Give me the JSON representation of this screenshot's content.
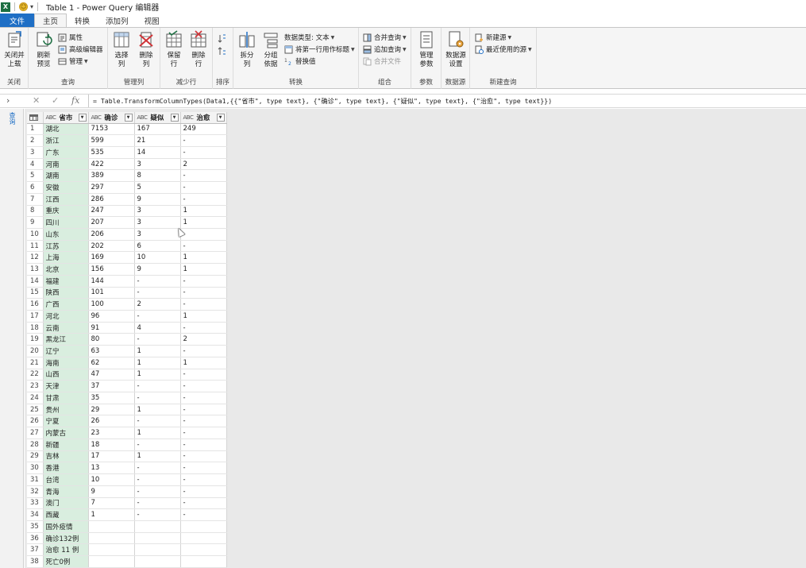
{
  "window": {
    "title": "Table 1 - Power Query 编辑器",
    "app_badge": "X"
  },
  "tabs": [
    "文件",
    "主页",
    "转换",
    "添加列",
    "视图"
  ],
  "ribbon": {
    "groups": {
      "close": "关闭",
      "query": "查询",
      "manage_cols": "管理列",
      "reduce_rows": "减少行",
      "sort": "排序",
      "transform": "转换",
      "combine": "组合",
      "params": "参数",
      "datasource": "数据源",
      "new_query": "新建查询"
    },
    "buttons": {
      "close_load": "关闭并\n上载",
      "refresh_preview": "刷新\n预览",
      "properties": "属性",
      "advanced_editor": "高级编辑器",
      "manage": "管理",
      "choose_columns": "选择\n列",
      "remove_columns": "删除\n列",
      "keep_rows": "保留\n行",
      "remove_rows": "删除\n行",
      "split_column": "拆分\n列",
      "group_by": "分组\n依据",
      "data_type": "数据类型: 文本",
      "first_row_header": "将第一行用作标题",
      "replace_values": "替换值",
      "merge_queries": "合并查询",
      "append_queries": "追加查询",
      "combine_files": "合并文件",
      "manage_params": "管理\n参数",
      "datasource_settings": "数据源\n设置",
      "new_source": "新建源",
      "recent_sources": "最近使用的源"
    }
  },
  "formula_bar": {
    "formula": "= Table.TransformColumnTypes(Data1,{{\"省市\", type text}, {\"确诊\", type text}, {\"疑似\", type text}, {\"治愈\", type text}})"
  },
  "query_pane": {
    "label": "查询"
  },
  "grid": {
    "columns": [
      {
        "type": "ABC",
        "name": "省市"
      },
      {
        "type": "ABC",
        "name": "确诊"
      },
      {
        "type": "ABC",
        "name": "疑似"
      },
      {
        "type": "ABC",
        "name": "治愈"
      }
    ],
    "rows": [
      [
        "湖北",
        "7153",
        "167",
        "249"
      ],
      [
        "浙江",
        "599",
        "21",
        "-"
      ],
      [
        "广东",
        "535",
        "14",
        "-"
      ],
      [
        "河南",
        "422",
        "3",
        "2"
      ],
      [
        "湖南",
        "389",
        "8",
        "-"
      ],
      [
        "安徽",
        "297",
        "5",
        "-"
      ],
      [
        "江西",
        "286",
        "9",
        "-"
      ],
      [
        "重庆",
        "247",
        "3",
        "1"
      ],
      [
        "四川",
        "207",
        "3",
        "1"
      ],
      [
        "山东",
        "206",
        "3",
        "-"
      ],
      [
        "江苏",
        "202",
        "6",
        "-"
      ],
      [
        "上海",
        "169",
        "10",
        "1"
      ],
      [
        "北京",
        "156",
        "9",
        "1"
      ],
      [
        "福建",
        "144",
        "-",
        "-"
      ],
      [
        "陕西",
        "101",
        "-",
        "-"
      ],
      [
        "广西",
        "100",
        "2",
        "-"
      ],
      [
        "河北",
        "96",
        "-",
        "1"
      ],
      [
        "云南",
        "91",
        "4",
        "-"
      ],
      [
        "黑龙江",
        "80",
        "-",
        "2"
      ],
      [
        "辽宁",
        "63",
        "1",
        "-"
      ],
      [
        "海南",
        "62",
        "1",
        "1"
      ],
      [
        "山西",
        "47",
        "1",
        "-"
      ],
      [
        "天津",
        "37",
        "-",
        "-"
      ],
      [
        "甘肃",
        "35",
        "-",
        "-"
      ],
      [
        "贵州",
        "29",
        "1",
        "-"
      ],
      [
        "宁夏",
        "26",
        "-",
        "-"
      ],
      [
        "内蒙古",
        "23",
        "1",
        "-"
      ],
      [
        "新疆",
        "18",
        "-",
        "-"
      ],
      [
        "吉林",
        "17",
        "1",
        "-"
      ],
      [
        "香港",
        "13",
        "-",
        "-"
      ],
      [
        "台湾",
        "10",
        "-",
        "-"
      ],
      [
        "青海",
        "9",
        "-",
        "-"
      ],
      [
        "澳门",
        "7",
        "-",
        "-"
      ],
      [
        "西藏",
        "1",
        "-",
        "-"
      ],
      [
        "国外疫情",
        "",
        "",
        ""
      ],
      [
        "确诊132例",
        "",
        "",
        ""
      ],
      [
        "治愈 11 例",
        "",
        "",
        ""
      ],
      [
        "死亡0例",
        "",
        "",
        ""
      ]
    ]
  },
  "colors": {
    "file_tab": "#1f6fc5",
    "first_col_highlight": "#d9eedf",
    "excel_green": "#1d6f42"
  }
}
